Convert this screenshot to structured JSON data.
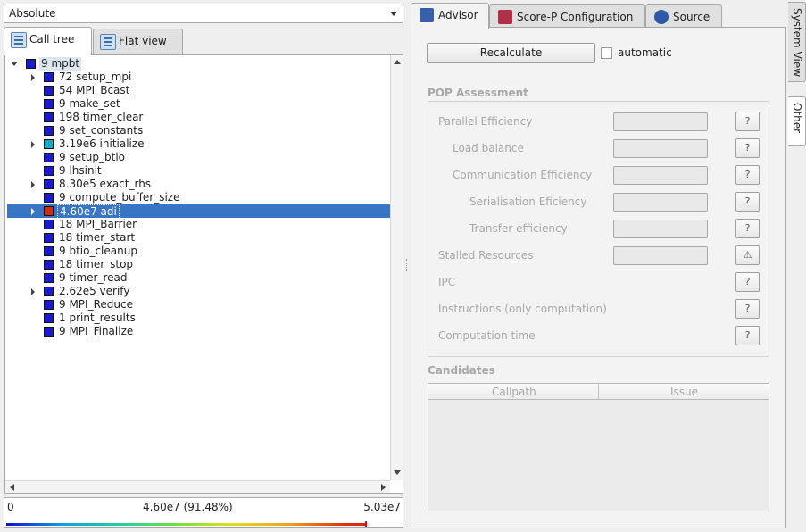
{
  "value_mode": "Absolute",
  "left_tabs": [
    {
      "label": "Call tree",
      "active": true
    },
    {
      "label": "Flat view",
      "active": false
    }
  ],
  "tree": [
    {
      "label": "9 mpbt",
      "depth": 0,
      "expander": "open",
      "color": "#1a1ad0",
      "root": true
    },
    {
      "label": "72 setup_mpi",
      "depth": 1,
      "expander": "closed",
      "color": "#1a1ad0"
    },
    {
      "label": "54 MPI_Bcast",
      "depth": 1,
      "expander": "",
      "color": "#1a1ad0"
    },
    {
      "label": "9 make_set",
      "depth": 1,
      "expander": "",
      "color": "#1a1ad0"
    },
    {
      "label": "198 timer_clear",
      "depth": 1,
      "expander": "",
      "color": "#1a1ad0"
    },
    {
      "label": "9 set_constants",
      "depth": 1,
      "expander": "",
      "color": "#1a1ad0"
    },
    {
      "label": "3.19e6 initialize",
      "depth": 1,
      "expander": "closed",
      "color": "#18a8c8"
    },
    {
      "label": "9 setup_btio",
      "depth": 1,
      "expander": "",
      "color": "#1a1ad0"
    },
    {
      "label": "9 lhsinit",
      "depth": 1,
      "expander": "",
      "color": "#1a1ad0"
    },
    {
      "label": "8.30e5 exact_rhs",
      "depth": 1,
      "expander": "closed",
      "color": "#1a1ad0"
    },
    {
      "label": "9 compute_buffer_size",
      "depth": 1,
      "expander": "",
      "color": "#1a1ad0"
    },
    {
      "label": "4.60e7 adi",
      "depth": 1,
      "expander": "closed",
      "color": "#d42a10",
      "selected": true
    },
    {
      "label": "18 MPI_Barrier",
      "depth": 1,
      "expander": "",
      "color": "#1a1ad0"
    },
    {
      "label": "18 timer_start",
      "depth": 1,
      "expander": "",
      "color": "#1a1ad0"
    },
    {
      "label": "9 btio_cleanup",
      "depth": 1,
      "expander": "",
      "color": "#1a1ad0"
    },
    {
      "label": "18 timer_stop",
      "depth": 1,
      "expander": "",
      "color": "#1a1ad0"
    },
    {
      "label": "9 timer_read",
      "depth": 1,
      "expander": "",
      "color": "#1a1ad0"
    },
    {
      "label": "2.62e5 verify",
      "depth": 1,
      "expander": "closed",
      "color": "#1a1ad0"
    },
    {
      "label": "9 MPI_Reduce",
      "depth": 1,
      "expander": "",
      "color": "#1a1ad0"
    },
    {
      "label": "1 print_results",
      "depth": 1,
      "expander": "",
      "color": "#1a1ad0"
    },
    {
      "label": "9 MPI_Finalize",
      "depth": 1,
      "expander": "",
      "color": "#1a1ad0"
    }
  ],
  "colorbar": {
    "min": "0",
    "current": "4.60e7 (91.48%)",
    "max": "5.03e7",
    "fraction": 0.9148
  },
  "right_tabs": [
    {
      "label": "Advisor",
      "active": true,
      "icon_color": "#3a5fa8"
    },
    {
      "label": "Score-P Configuration",
      "active": false,
      "icon_color": "#b03048"
    },
    {
      "label": "Source",
      "active": false,
      "icon_color": "#2a5aa8"
    }
  ],
  "advisor": {
    "recalculate_label": "Recalculate",
    "automatic_label": "automatic",
    "pop_title": "POP Assessment",
    "pop_rows": [
      {
        "label": "Parallel Efficiency",
        "indent": 0,
        "field": true,
        "icon": "?"
      },
      {
        "label": "Load balance",
        "indent": 1,
        "field": true,
        "icon": "?"
      },
      {
        "label": "Communication Efficiency",
        "indent": 1,
        "field": true,
        "icon": "?"
      },
      {
        "label": "Serialisation Eficiency",
        "indent": 2,
        "field": true,
        "icon": "?"
      },
      {
        "label": "Transfer efficiency",
        "indent": 2,
        "field": true,
        "icon": "?"
      },
      {
        "label": "Stalled Resources",
        "indent": 0,
        "field": true,
        "icon": "⚠"
      },
      {
        "label": "IPC",
        "indent": 0,
        "field": false,
        "icon": "?"
      },
      {
        "label": "Instructions (only computation)",
        "indent": 0,
        "field": false,
        "icon": "?"
      },
      {
        "label": "Computation time",
        "indent": 0,
        "field": false,
        "icon": "?"
      }
    ],
    "candidates_title": "Candidates",
    "columns": [
      "Callpath",
      "Issue"
    ]
  },
  "side_tabs": [
    {
      "label": "System View",
      "active": false
    },
    {
      "label": "Other",
      "active": true
    }
  ]
}
